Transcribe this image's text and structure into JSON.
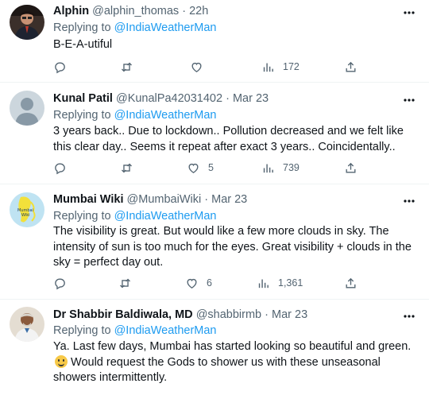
{
  "tweets": [
    {
      "name": "Alphin",
      "handle": "@alphin_thomas",
      "separator": "·",
      "time": "22h",
      "replying_prefix": "Replying to",
      "replying_to": "@IndiaWeatherMan",
      "text": "B-E-A-utiful",
      "text_suffix": "",
      "replies": "",
      "retweets": "",
      "likes": "",
      "views": "172"
    },
    {
      "name": "Kunal Patil",
      "handle": "@KunalPa42031402",
      "separator": "·",
      "time": "Mar 23",
      "replying_prefix": "Replying to",
      "replying_to": "@IndiaWeatherMan",
      "text": "3 years back.. Due to lockdown.. Pollution decreased and we felt like this clear day.. Seems it repeat after exact 3 years.. Coincidentally..",
      "text_suffix": "",
      "replies": "",
      "retweets": "",
      "likes": "5",
      "views": "739"
    },
    {
      "name": "Mumbai Wiki",
      "handle": "@MumbaiWiki",
      "separator": "·",
      "time": "Mar 23",
      "replying_prefix": "Replying to",
      "replying_to": "@IndiaWeatherMan",
      "text": "The visibility is great. But would like a few more clouds in sky. The intensity of sun is too much for the eyes. Great visibility + clouds in the sky = perfect day out.",
      "text_suffix": "",
      "replies": "",
      "retweets": "",
      "likes": "6",
      "views": "1,361"
    },
    {
      "name": "Dr Shabbir Baldiwala, MD",
      "handle": "@shabbirmb",
      "separator": "·",
      "time": "Mar 23",
      "replying_prefix": "Replying to",
      "replying_to": "@IndiaWeatherMan",
      "text": "Ya. Last few days, Mumbai has started looking so beautiful and green.",
      "text_suffix": "Would request the Gods to shower us with these unseasonal showers intermittently.",
      "replies": "",
      "retweets": "",
      "likes": "",
      "views": ""
    }
  ],
  "colors": {
    "link": "#1d9bf0",
    "muted": "#536471",
    "text": "#0f1419",
    "divider": "#eff3f4"
  },
  "icons": [
    "reply-icon",
    "retweet-icon",
    "like-icon",
    "views-icon",
    "share-icon",
    "more-icon",
    "smiley-emoji"
  ]
}
